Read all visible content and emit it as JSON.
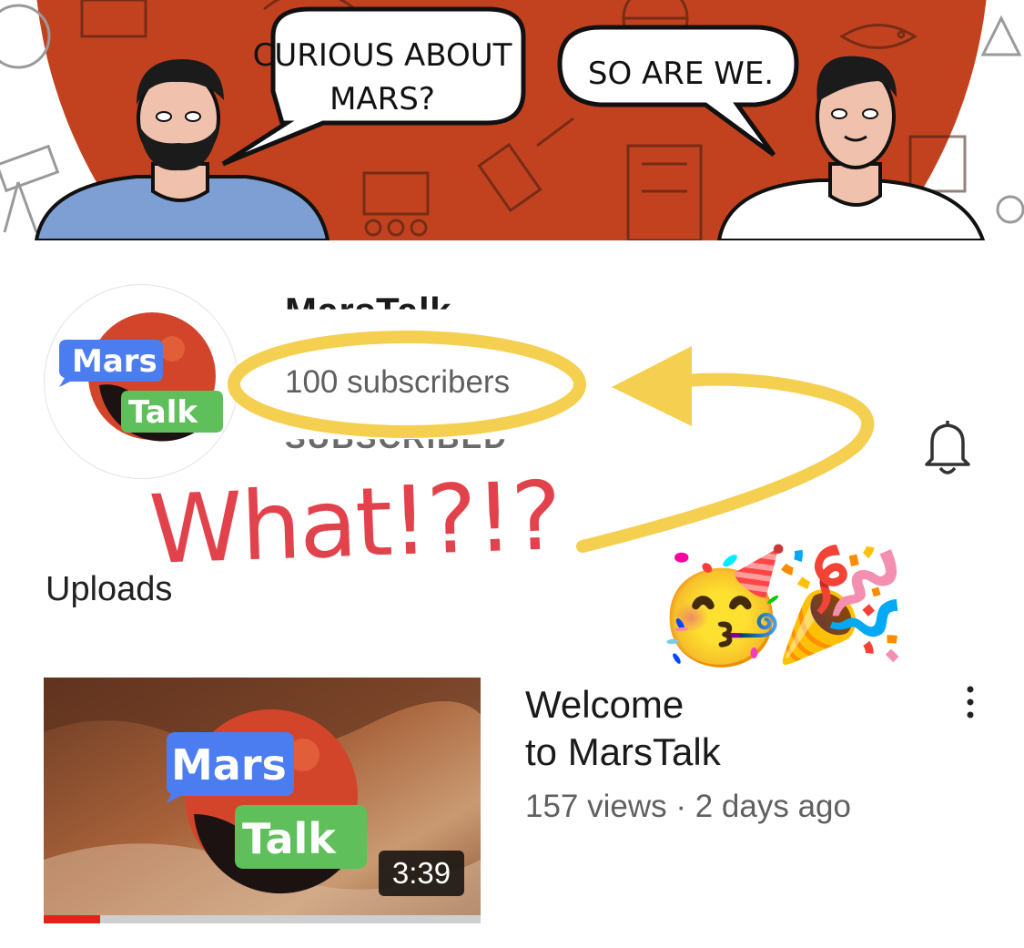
{
  "banner": {
    "bubble_left_line1": "CURIOUS ABOUT",
    "bubble_left_line2": "MARS?",
    "bubble_right": "SO ARE WE."
  },
  "channel": {
    "logo_word1": "Mars",
    "logo_word2": "Talk",
    "name": "MarsTalk",
    "subscribers": "100 subscribers",
    "subscribe_state": "SUBSCRIBED"
  },
  "annotation": {
    "text": "What!?!?",
    "emojis": [
      "🥳",
      "🎉"
    ],
    "highlight_color": "#f5cf4f",
    "text_color": "#e2424b"
  },
  "section": {
    "uploads_label": "Uploads"
  },
  "video": {
    "title_line1": "Welcome",
    "title_line2": "to MarsTalk",
    "meta": "157 views · 2 days ago",
    "duration": "3:39",
    "watched_fraction": 0.13,
    "thumb_logo_word1": "Mars",
    "thumb_logo_word2": "Talk"
  },
  "icons": {
    "bell": "bell-icon",
    "more": "more-vertical-icon"
  },
  "colors": {
    "banner_red": "#c2421f",
    "logo_blue": "#4b7df0",
    "logo_green": "#5fbf5a",
    "progress_red": "#e62117"
  }
}
